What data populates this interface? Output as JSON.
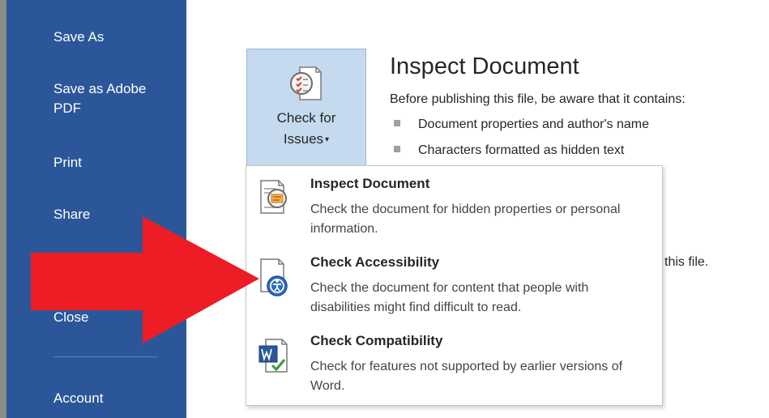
{
  "sidebar": {
    "items": [
      {
        "label": "Save As"
      },
      {
        "label": "Save as Adobe PDF"
      },
      {
        "label": "Print"
      },
      {
        "label": "Share"
      },
      {
        "label": "Close"
      },
      {
        "label": "Account"
      }
    ],
    "background": "#2b579a"
  },
  "issues_button": {
    "label_line1": "Check for",
    "label_line2": "Issues",
    "caret": "▾",
    "icon": "inspect-checklist-icon"
  },
  "inspect": {
    "title": "Inspect Document",
    "description": "Before publishing this file, be aware that it contains:",
    "bullets": [
      "Document properties and author's name",
      "Characters formatted as hidden text"
    ],
    "partial_text": "this file."
  },
  "dropdown": {
    "items": [
      {
        "title": "Inspect Document",
        "description": "Check the document for hidden properties or personal information.",
        "icon": "inspect-document-icon"
      },
      {
        "title": "Check Accessibility",
        "description": "Check the document for content that people with disabilities might find difficult to read.",
        "icon": "accessibility-icon"
      },
      {
        "title": "Check Compatibility",
        "description": "Check for features not supported by earlier versions of Word.",
        "icon": "compatibility-icon"
      }
    ]
  },
  "annotation": {
    "arrow_color": "#ee1c24"
  }
}
